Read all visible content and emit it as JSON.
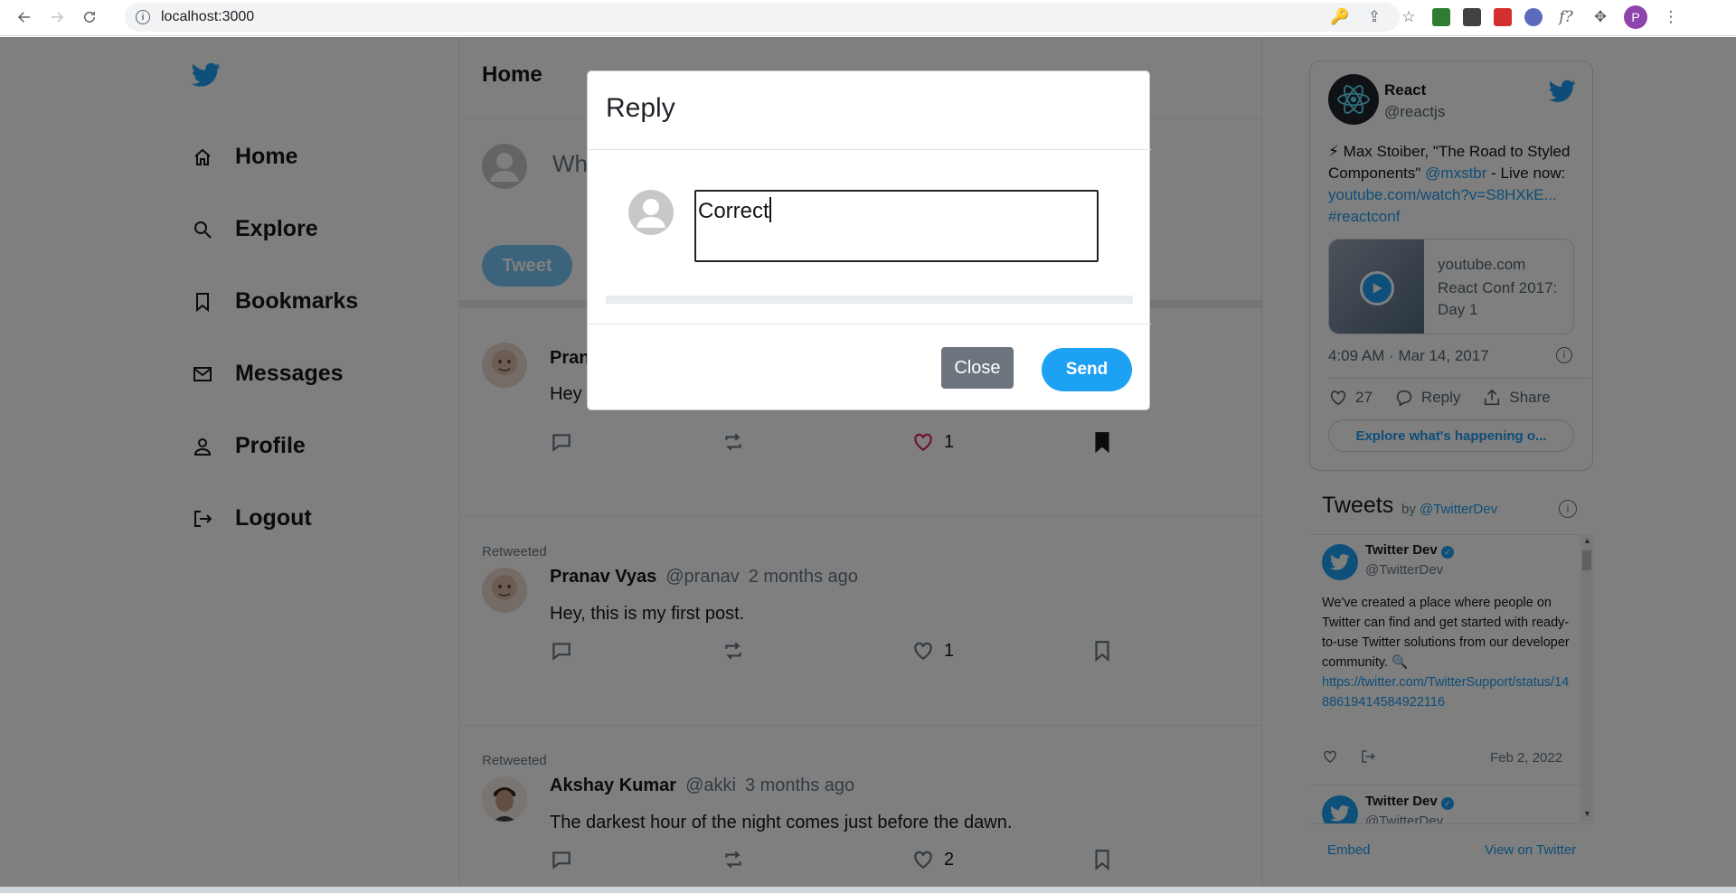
{
  "browser": {
    "url": "localhost:3000"
  },
  "colors": {
    "brand": "#1da1f2",
    "like_active": "#e0245e",
    "overlay": "rgba(0,0,0,0.5)"
  },
  "sidebar": {
    "logo_icon": "twitter-bird-icon",
    "items": [
      {
        "label": "Home",
        "icon": "home-icon"
      },
      {
        "label": "Explore",
        "icon": "search-icon"
      },
      {
        "label": "Bookmarks",
        "icon": "bookmark-icon"
      },
      {
        "label": "Messages",
        "icon": "mail-icon"
      },
      {
        "label": "Profile",
        "icon": "user-icon"
      },
      {
        "label": "Logout",
        "icon": "logout-icon"
      }
    ]
  },
  "main": {
    "title": "Home",
    "compose_placeholder": "Wh",
    "tweet_button": "Tweet",
    "posts": [
      {
        "retweeted": "",
        "name": "Pran",
        "handle": "",
        "time": "",
        "text": "Hey",
        "likes": "1",
        "liked": true,
        "bookmarked": true
      },
      {
        "retweeted": "Retweeted",
        "name": "Pranav Vyas",
        "handle": "@pranav",
        "time": "2 months ago",
        "text": "Hey, this is my first post.",
        "likes": "1",
        "liked": false,
        "bookmarked": false
      },
      {
        "retweeted": "Retweeted",
        "name": "Akshay Kumar",
        "handle": "@akki",
        "time": "3 months ago",
        "text": "The darkest hour of the night comes just before the dawn.",
        "likes": "2",
        "liked": false,
        "bookmarked": false
      }
    ]
  },
  "embed": {
    "name": "React",
    "handle": "@reactjs",
    "text_prefix": "⚡ Max Stoiber, \"The Road to Styled Components\" ",
    "mention": "@mxstbr",
    "text_mid": " - Live now: ",
    "link": "youtube.com/watch?v=S8HXkE...",
    "hashtag": " #reactconf",
    "media_domain": "youtube.com",
    "media_title": "React Conf 2017: Day 1",
    "date": "4:09 AM · Mar 14, 2017",
    "likes": "27",
    "reply": "Reply",
    "share": "Share",
    "explore": "Explore what's happening o..."
  },
  "timeline": {
    "title": "Tweets",
    "by": "by",
    "by_handle": "@TwitterDev",
    "tweets": [
      {
        "name": "Twitter Dev",
        "handle": "@TwitterDev",
        "text": "We've created a place where people on Twitter can find and get started with ready-to-use Twitter solutions from our developer community. 🔍",
        "link": "https://twitter.com/TwitterSupport/status/1488619414584922116",
        "date": "Feb 2, 2022"
      },
      {
        "name": "Twitter Dev",
        "handle": "@TwitterDev"
      }
    ],
    "embed": "Embed",
    "view": "View on Twitter"
  },
  "modal": {
    "title": "Reply",
    "input_value": "Correct",
    "close": "Close",
    "send": "Send"
  }
}
